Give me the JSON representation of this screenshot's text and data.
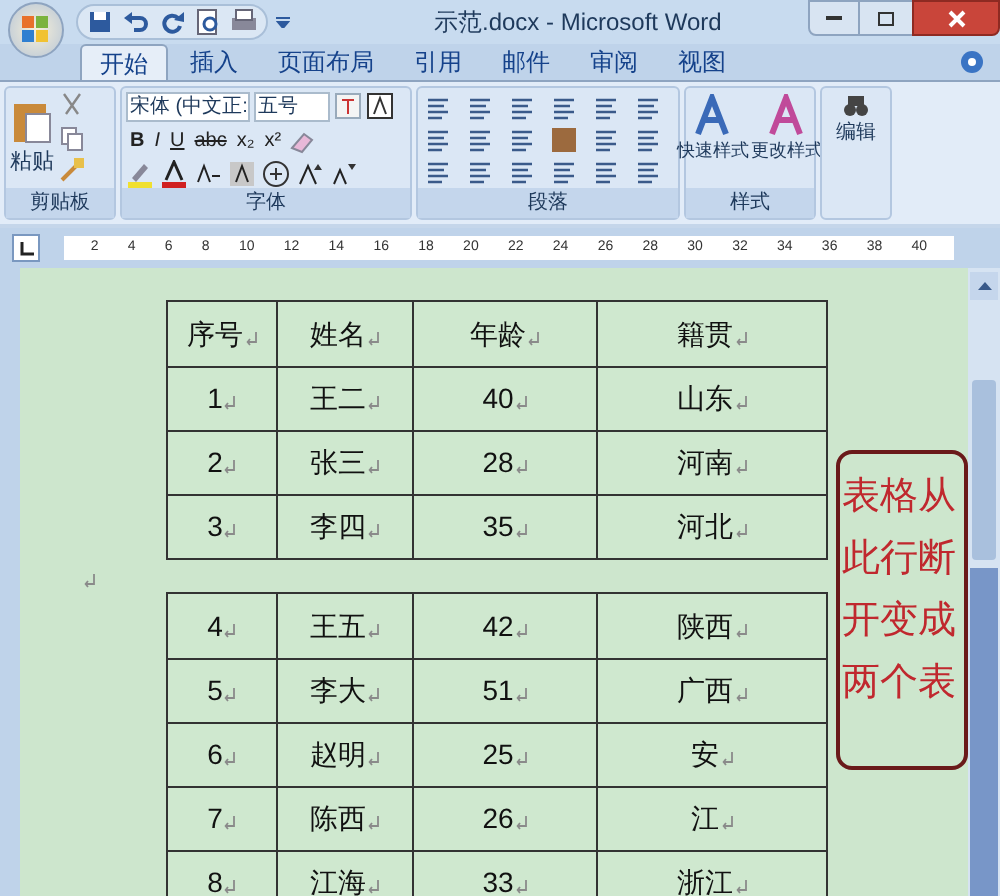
{
  "title": "示范.docx - Microsoft Word",
  "tabs": [
    {
      "label": "开始",
      "selected": true
    },
    {
      "label": "插入",
      "selected": false
    },
    {
      "label": "页面布局",
      "selected": false
    },
    {
      "label": "引用",
      "selected": false
    },
    {
      "label": "邮件",
      "selected": false
    },
    {
      "label": "审阅",
      "selected": false
    },
    {
      "label": "视图",
      "selected": false
    }
  ],
  "ribbon": {
    "clipboard": {
      "paste": "粘贴",
      "label": "剪贴板"
    },
    "font": {
      "name": "宋体 (中文正:",
      "size": "五号",
      "format_buttons": [
        "B",
        "I",
        "U",
        "abc",
        "x₂",
        "x²"
      ],
      "label": "字体"
    },
    "paragraph": {
      "label": "段落"
    },
    "styles": {
      "buttons": [
        "快速样式",
        "更改样式"
      ],
      "label": "样式"
    },
    "editing": {
      "label": "编辑"
    }
  },
  "ruler": {
    "ticks": [
      "2",
      "4",
      "6",
      "8",
      "10",
      "12",
      "14",
      "16",
      "18",
      "20",
      "22",
      "24",
      "26",
      "28",
      "30",
      "32",
      "34",
      "36",
      "38",
      "40"
    ]
  },
  "tables": [
    {
      "rows": [
        [
          "序号",
          "姓名",
          "年龄",
          "籍贯"
        ],
        [
          "1",
          "王二",
          "40",
          "山东"
        ],
        [
          "2",
          "张三",
          "28",
          "河南"
        ],
        [
          "3",
          "李四",
          "35",
          "河北"
        ]
      ]
    },
    {
      "rows": [
        [
          "4",
          "王五",
          "42",
          "陕西"
        ],
        [
          "5",
          "李大",
          "51",
          "广西"
        ],
        [
          "6",
          "赵明",
          "25",
          "安"
        ],
        [
          "7",
          "陈西",
          "26",
          "江"
        ],
        [
          "8",
          "江海",
          "33",
          "浙江"
        ]
      ]
    }
  ],
  "callout": {
    "text": "表格从此行断开变成两个表"
  }
}
